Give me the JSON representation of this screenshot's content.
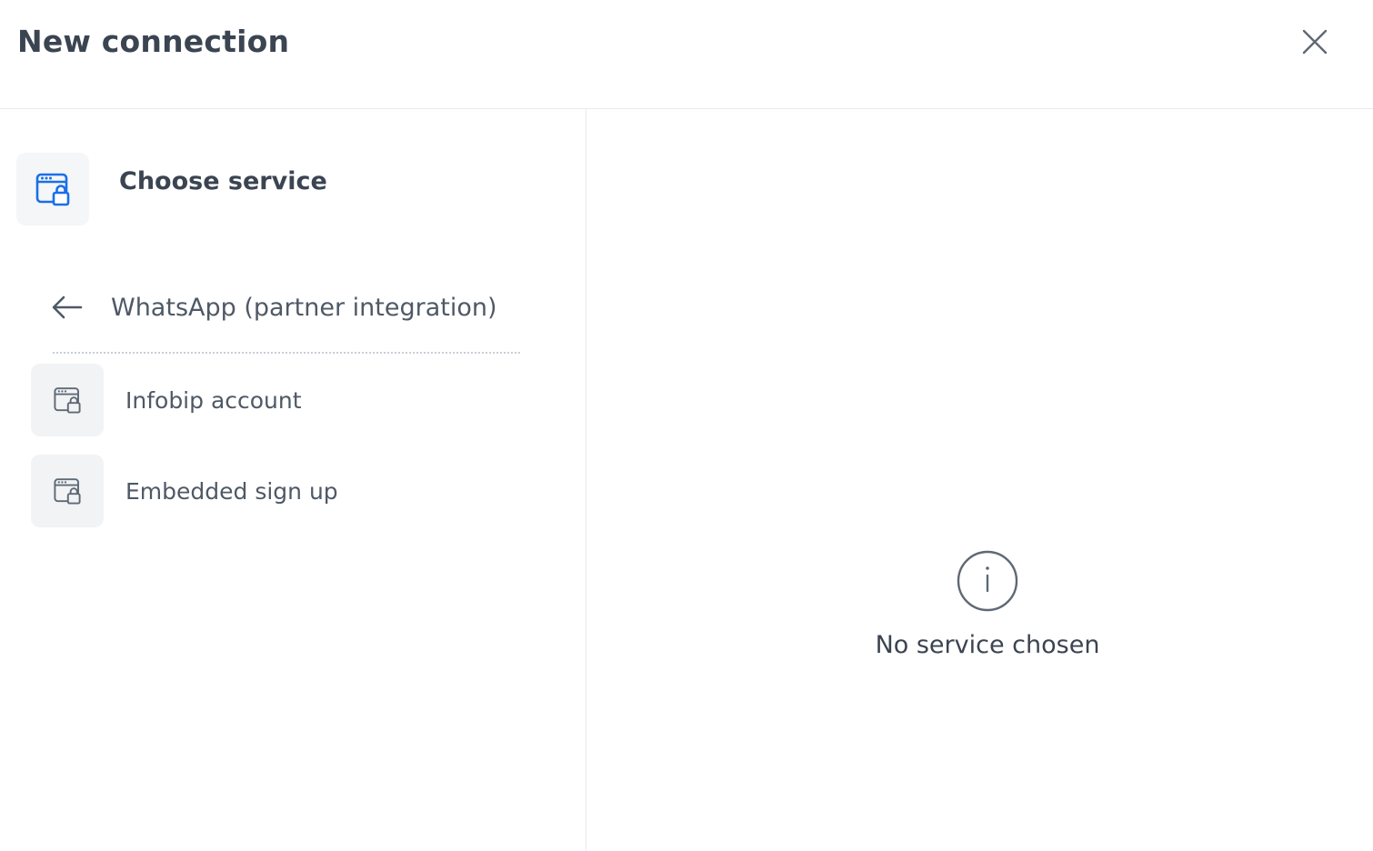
{
  "header": {
    "title": "New connection",
    "close_icon": "close-icon"
  },
  "steps": {
    "current_step_label": "Choose service",
    "current_step_icon": "browser-lock-icon"
  },
  "service_group": {
    "back_label": "WhatsApp (partner integration)",
    "back_icon": "arrow-left-icon",
    "options": [
      {
        "label": "Infobip account",
        "icon": "browser-lock-icon"
      },
      {
        "label": "Embedded sign up",
        "icon": "browser-lock-icon"
      }
    ]
  },
  "details": {
    "empty_icon": "info-icon",
    "empty_text": "No service chosen"
  },
  "colors": {
    "accent": "#1a6fe8",
    "text": "#3b4451",
    "muted_icon": "#5f6975",
    "tile_bg": "#f4f6f8",
    "divider": "#e8ebef"
  }
}
